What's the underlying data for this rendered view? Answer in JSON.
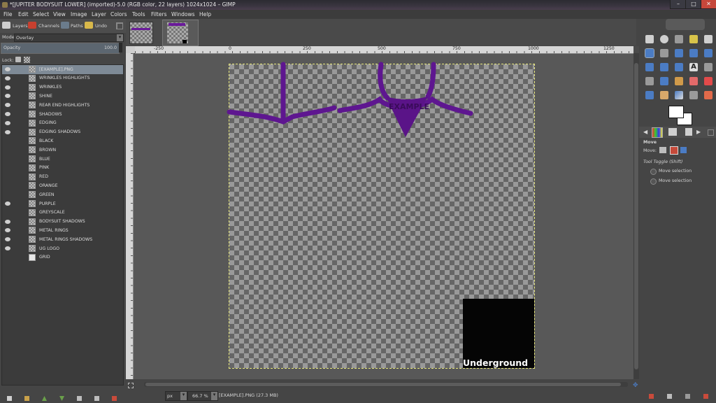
{
  "window": {
    "title": "*[JUPITER BODYSUIT LOWER] (imported)-5.0 (RGB color, 22 layers) 1024x1024 – GIMP"
  },
  "menu": [
    "File",
    "Edit",
    "Select",
    "View",
    "Image",
    "Layer",
    "Colors",
    "Tools",
    "Filters",
    "Windows",
    "Help"
  ],
  "dock_tabs": [
    {
      "label": "Layers",
      "icon": "layers-icon"
    },
    {
      "label": "Channels",
      "icon": "channels-icon"
    },
    {
      "label": "Paths",
      "icon": "paths-icon"
    },
    {
      "label": "Undo",
      "icon": "undo-icon"
    }
  ],
  "layers_panel": {
    "mode_label": "Mode:",
    "mode_value": "Overlay",
    "opacity_label": "Opacity",
    "opacity_value": "100.0",
    "lock_label": "Lock:",
    "layers": [
      {
        "name": "[EXAMPLE].PNG",
        "visible": true,
        "selected": true
      },
      {
        "name": "WRINKLES HIGHLIGHTS",
        "visible": true
      },
      {
        "name": "WRINKLES",
        "visible": true
      },
      {
        "name": "SHINE",
        "visible": true
      },
      {
        "name": "REAR END HIGHLIGHTS",
        "visible": true
      },
      {
        "name": "SHADOWS",
        "visible": true
      },
      {
        "name": "EDGING",
        "visible": true
      },
      {
        "name": "EDGING SHADOWS",
        "visible": true
      },
      {
        "name": "BLACK",
        "visible": false
      },
      {
        "name": "BROWN",
        "visible": false
      },
      {
        "name": "BLUE",
        "visible": false
      },
      {
        "name": "PINK",
        "visible": false
      },
      {
        "name": "RED",
        "visible": false
      },
      {
        "name": "ORANGE",
        "visible": false
      },
      {
        "name": "GREEN",
        "visible": false
      },
      {
        "name": "PURPLE",
        "visible": true
      },
      {
        "name": "GREYSCALE",
        "visible": false
      },
      {
        "name": "BODYSUIT SHADOWS",
        "visible": true
      },
      {
        "name": "METAL RINGS",
        "visible": true
      },
      {
        "name": "METAL RINGS SHADOWS",
        "visible": true
      },
      {
        "name": "UG LOGO",
        "visible": true
      },
      {
        "name": "GRID",
        "visible": false
      }
    ]
  },
  "ruler": {
    "h_ticks": [
      "-250",
      "0",
      "250",
      "500",
      "750",
      "1000",
      "1250"
    ]
  },
  "canvas": {
    "logo_text": "Underground",
    "watermark_text": "EXAMPLE"
  },
  "status": {
    "unit": "px",
    "zoom": "66.7 %",
    "info": "[EXAMPLE].PNG (27.3 MB)"
  },
  "tool_options": {
    "title": "Move",
    "move_label": "Move:",
    "toggle_label": "Tool Toggle  (Shift)",
    "options": [
      "Move selection",
      "Move selection"
    ]
  },
  "colors": {
    "accent": "#4b7cc4",
    "suit_purple": "#6a1a9a",
    "selected_row": "#7e8a96"
  }
}
